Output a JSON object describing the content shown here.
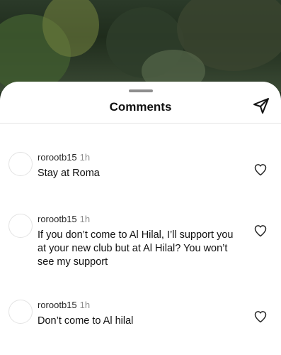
{
  "header": {
    "title": "Comments"
  },
  "comments": [
    {
      "username": "rorootb15",
      "time": "1h",
      "text": "Stay at Roma"
    },
    {
      "username": "rorootb15",
      "time": "1h",
      "text": "If you don’t come to Al Hilal, I’ll support you at your new club but at Al Hilal? You won’t see my support"
    },
    {
      "username": "rorootb15",
      "time": "1h",
      "text": "Don’t come to Al hilal"
    }
  ],
  "icons": {
    "share": "paper-plane-icon",
    "like": "heart-outline-icon",
    "avatar": "avatar-placeholder"
  },
  "colors": {
    "sheet": "#ffffff",
    "text": "#111111",
    "muted": "#8e8e8e"
  }
}
